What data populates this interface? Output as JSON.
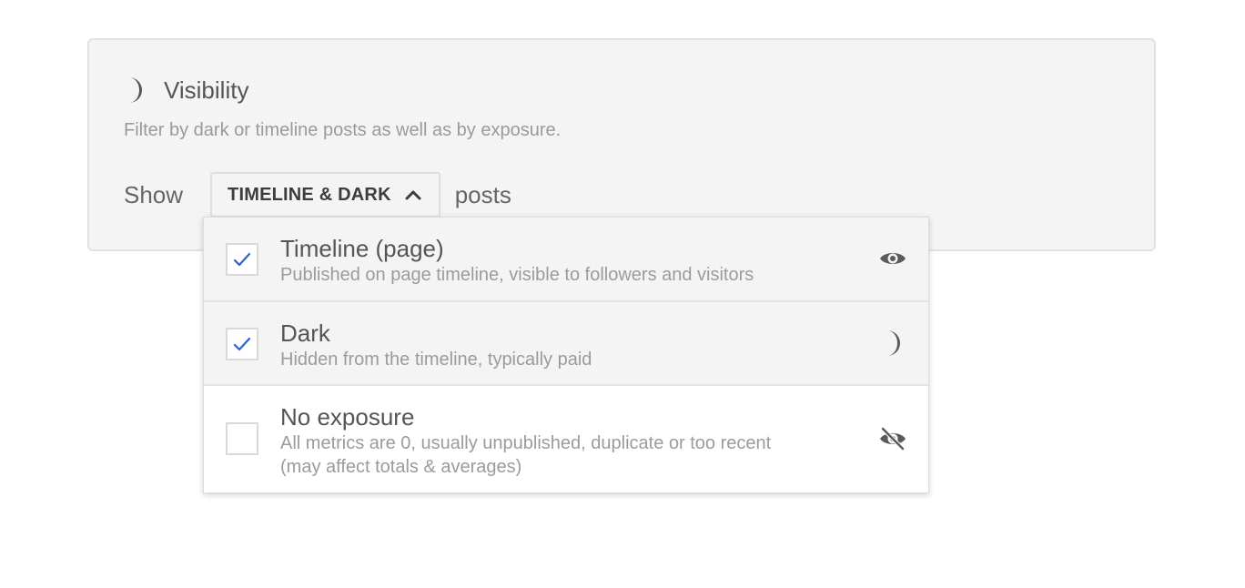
{
  "panel": {
    "title": "Visibility",
    "icon": "moon-icon",
    "description": "Filter by dark or timeline posts as well as by exposure."
  },
  "filter": {
    "prefix": "Show",
    "selected_label": "TIMELINE & DARK",
    "suffix": "posts",
    "expanded": true
  },
  "options": [
    {
      "title": "Timeline (page)",
      "description": "Published on page timeline, visible to followers and visitors",
      "checked": true,
      "icon": "eye-icon"
    },
    {
      "title": "Dark",
      "description": "Hidden from the timeline, typically paid",
      "checked": true,
      "icon": "moon-icon"
    },
    {
      "title": "No exposure",
      "description": "All metrics are 0, usually unpublished, duplicate or too recent",
      "description_line2": "(may affect totals & averages)",
      "checked": false,
      "icon": "eye-slash-icon"
    }
  ],
  "colors": {
    "checkmark": "#2f5fd0",
    "icon": "#5a5a5a",
    "panel_bg": "#f4f4f4"
  }
}
